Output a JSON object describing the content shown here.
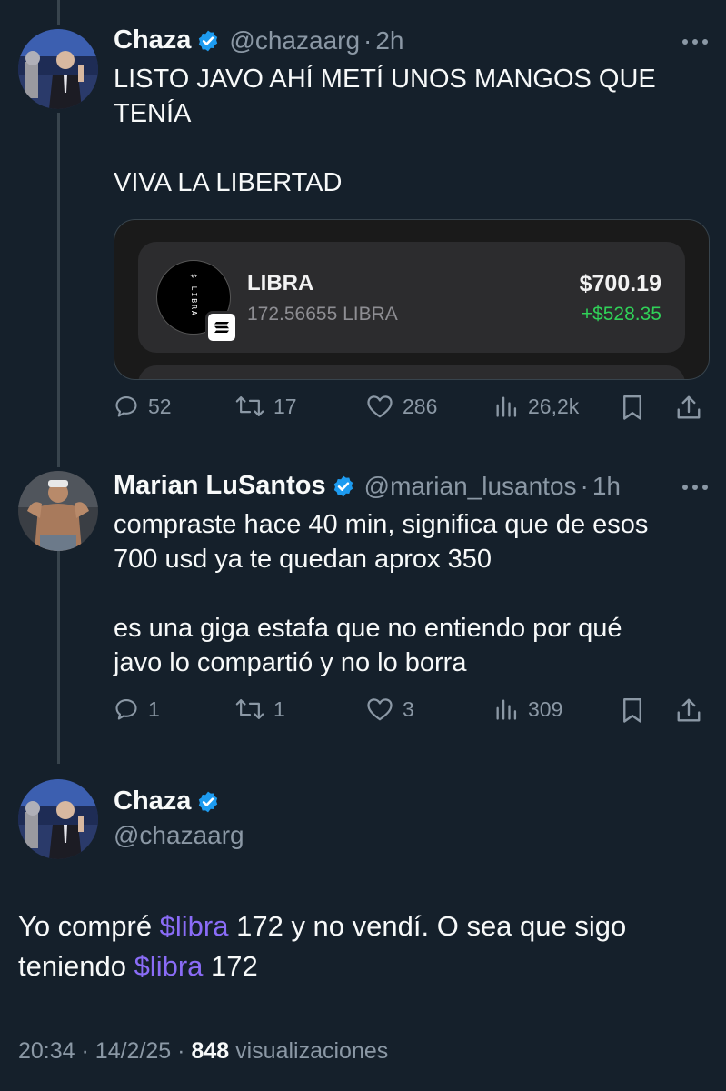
{
  "tweet1": {
    "name": "Chaza",
    "handle": "@chazaarg",
    "dot": "·",
    "time": "2h",
    "line1": "LISTO JAVO AHÍ METÍ UNOS MANGOS QUE",
    "line2": "TENÍA",
    "line3": "VIVA LA LIBERTAD",
    "card": {
      "logo_text": "$ LIBRA",
      "token_name": "LIBRA",
      "token_amount": "172.56655 LIBRA",
      "value": "$700.19",
      "gain": "+$528.35"
    },
    "replies": "52",
    "reposts": "17",
    "likes": "286",
    "views": "26,2k"
  },
  "tweet2": {
    "name": "Marian LuSantos",
    "handle": "@marian_lusantos",
    "dot": "·",
    "time": "1h",
    "line1": "compraste hace 40 min, significa que de esos",
    "line2": "700 usd ya te quedan aprox 350",
    "line3": "es una giga estafa que no entiendo por qué",
    "line4": "javo lo compartió y no lo borra",
    "replies": "1",
    "reposts": "1",
    "likes": "3",
    "views": "309"
  },
  "tweet3": {
    "name": "Chaza",
    "handle": "@chazaarg",
    "text_a": "Yo compré ",
    "cashtag1": "$libra",
    "text_b": " 172 y no vendí. O sea que sigo",
    "text_c": "teniendo ",
    "cashtag2": "$libra",
    "text_d": " 172",
    "time": "20:34",
    "date": "14/2/25",
    "sep": "·",
    "views_count": "848",
    "views_label": "visualizaciones"
  },
  "icons": [
    "reply-icon",
    "repost-icon",
    "like-icon",
    "views-icon",
    "bookmark-icon",
    "share-icon",
    "verified-icon",
    "more-icon",
    "solana-icon"
  ],
  "colors": {
    "background": "#15202b",
    "text": "#f7f9f9",
    "secondary": "#8b98a5",
    "verified": "#1d9bf0",
    "cashtag": "#8a6cf7",
    "gain": "#30d158",
    "divider": "#38444d"
  }
}
